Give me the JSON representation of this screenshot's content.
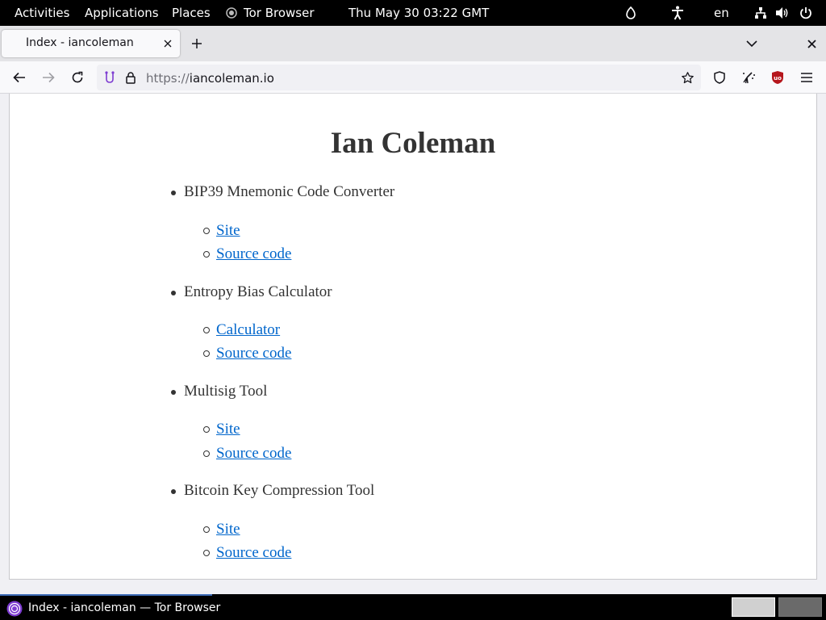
{
  "topbar": {
    "activities": "Activities",
    "applications": "Applications",
    "places": "Places",
    "app_name": "Tor Browser",
    "clock": "Thu May 30  03:22 GMT",
    "language": "en"
  },
  "tab": {
    "title": "Index - iancoleman"
  },
  "urlbar": {
    "protocol": "https://",
    "host": "iancoleman.io"
  },
  "page": {
    "title": "Ian Coleman",
    "sections": [
      {
        "title": "BIP39 Mnemonic Code Converter",
        "links": [
          "Site",
          "Source code"
        ]
      },
      {
        "title": "Entropy Bias Calculator",
        "links": [
          "Calculator",
          "Source code"
        ]
      },
      {
        "title": "Multisig Tool",
        "links": [
          "Site",
          "Source code"
        ]
      },
      {
        "title": "Bitcoin Key Compression Tool",
        "links": [
          "Site",
          "Source code"
        ]
      }
    ]
  },
  "taskbar": {
    "window_title": "Index - iancoleman — Tor Browser"
  },
  "colors": {
    "link": "#0066cc",
    "tor_purple": "#7d3bd1",
    "ublock_red": "#b5161c"
  }
}
